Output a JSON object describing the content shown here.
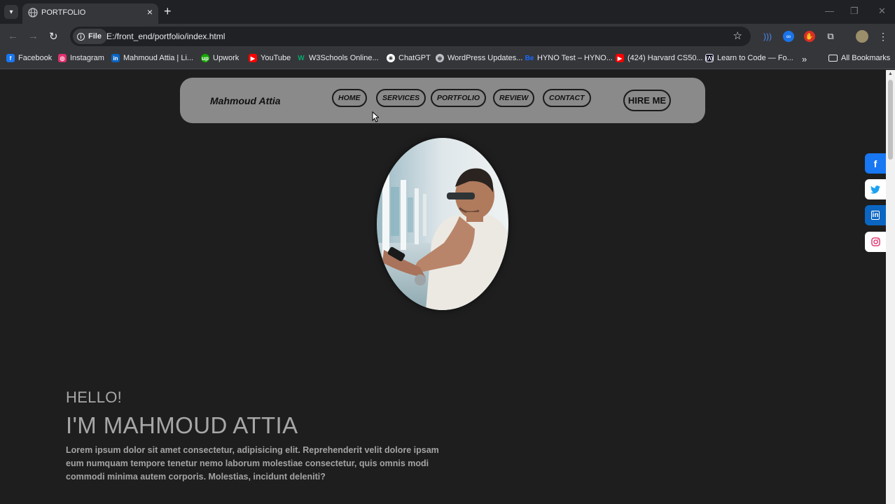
{
  "browser": {
    "tab_title": "PORTFOLIO",
    "file_chip": "File",
    "url": "E:/front_end/portfolio/index.html",
    "bookmarks": [
      {
        "label": "Facebook",
        "icon": "facebook-icon",
        "color": "#1877f2"
      },
      {
        "label": "Instagram",
        "icon": "instagram-icon",
        "color": "#e1306c"
      },
      {
        "label": "Mahmoud Attia | Li...",
        "icon": "linkedin-icon",
        "color": "#0a66c2"
      },
      {
        "label": "Upwork",
        "icon": "upwork-icon",
        "color": "#14a800"
      },
      {
        "label": "YouTube",
        "icon": "youtube-icon",
        "color": "#ff0000"
      },
      {
        "label": "W3Schools Online...",
        "icon": "w3schools-icon",
        "color": "#04aa6d"
      },
      {
        "label": "ChatGPT",
        "icon": "chatgpt-icon",
        "color": "#ffffff"
      },
      {
        "label": "WordPress Updates...",
        "icon": "globe-icon",
        "color": "#bdc1c6"
      },
      {
        "label": "HYNO Test – HYNO...",
        "icon": "behance-icon",
        "color": "#1769ff"
      },
      {
        "label": "(424) Harvard CS50...",
        "icon": "youtube-icon",
        "color": "#ff0000"
      },
      {
        "label": "Learn to Code — Fo...",
        "icon": "freecodecamp-icon",
        "color": "#0a0a23"
      }
    ],
    "all_bookmarks": "All Bookmarks"
  },
  "page": {
    "brand": "Mahmoud Attia",
    "nav": [
      "HOME",
      "SERVICES",
      "PORTFOLIO",
      "REVIEW",
      "CONTACT"
    ],
    "hire_button": "HIRE ME",
    "hello": "HELLO!",
    "name": "I'M MAHMOUD ATTIA",
    "bio": "Lorem ipsum dolor sit amet consectetur, adipisicing elit. Reprehenderit velit dolore ipsam eum numquam tempore tenetur nemo laborum molestiae consectetur, quis omnis modi commodi minima autem corporis. Molestias, incidunt deleniti?",
    "social": [
      {
        "name": "facebook",
        "icon": "facebook-icon",
        "color": "#1877f2"
      },
      {
        "name": "twitter",
        "icon": "twitter-icon",
        "color": "#1da1f2"
      },
      {
        "name": "linkedin",
        "icon": "linkedin-icon",
        "color": "#0a66c2"
      },
      {
        "name": "instagram",
        "icon": "instagram-icon",
        "color": "#e1306c"
      }
    ]
  }
}
